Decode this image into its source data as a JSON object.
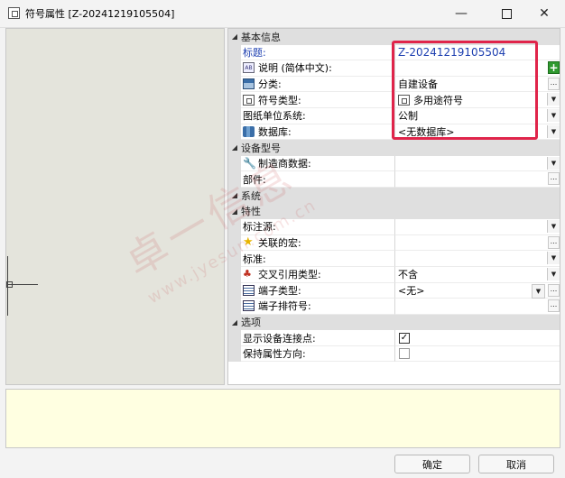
{
  "window": {
    "title": "符号属性 [Z-20241219105504]",
    "controls": {
      "minimize": "—",
      "maximize": "",
      "close": "✕"
    }
  },
  "grid": {
    "categories": [
      {
        "label": "基本信息",
        "rows": [
          {
            "name": "标题:",
            "value": "Z-20241219105504",
            "icon": "",
            "control": ""
          },
          {
            "name": "说明 (简体中文):",
            "value": "",
            "icon": "text-abc-icon",
            "control": "plus"
          },
          {
            "name": "分类:",
            "value": "自建设备",
            "icon": "category-icon",
            "control": "ellipsis"
          },
          {
            "name": "符号类型:",
            "value": "多用途符号",
            "icon": "symbol-icon",
            "control": "dropdown"
          },
          {
            "name": "图纸单位系统:",
            "value": "公制",
            "icon": "",
            "control": "dropdown"
          },
          {
            "name": "数据库:",
            "value": "<无数据库>",
            "icon": "database-icon",
            "control": "dropdown"
          }
        ]
      },
      {
        "label": "设备型号",
        "rows": [
          {
            "name": "制造商数据:",
            "value": "",
            "icon": "wrench-icon",
            "control": "dropdown"
          },
          {
            "name": "部件:",
            "value": "",
            "icon": "",
            "control": "ellipsis"
          }
        ]
      },
      {
        "label": "系统",
        "rows": []
      },
      {
        "label": "特性",
        "rows": [
          {
            "name": "标注源:",
            "value": "",
            "icon": "",
            "control": "dropdown"
          },
          {
            "name": "关联的宏:",
            "value": "",
            "icon": "star-icon",
            "control": "ellipsis"
          },
          {
            "name": "标准:",
            "value": "",
            "icon": "",
            "control": "dropdown"
          },
          {
            "name": "交叉引用类型:",
            "value": "不含",
            "icon": "cross-reference-icon",
            "control": "dropdown"
          },
          {
            "name": "端子类型:",
            "value": "<无>",
            "icon": "terminal-icon",
            "control": "dropdown-ellipsis"
          },
          {
            "name": "端子排符号:",
            "value": "",
            "icon": "terminal-strip-icon",
            "control": "ellipsis"
          }
        ]
      },
      {
        "label": "选项",
        "rows": [
          {
            "name": "显示设备连接点:",
            "value": "✓",
            "icon": "",
            "control": "checkbox-on"
          },
          {
            "name": "保持属性方向:",
            "value": "",
            "icon": "",
            "control": "checkbox-off"
          }
        ]
      }
    ],
    "toggle_glyph": "◢",
    "dropdown_glyph": "▼",
    "ellipsis_glyph": "...",
    "plus_glyph": "+"
  },
  "watermark": {
    "line1": "卓一信息",
    "line2": "www.jyesun.com.cn"
  },
  "buttons": {
    "ok": "确定",
    "cancel": "取消"
  },
  "colors": {
    "accent_text": "#1d3fb0",
    "highlight_border": "#e0244a",
    "description_bg": "#ffffe1"
  }
}
